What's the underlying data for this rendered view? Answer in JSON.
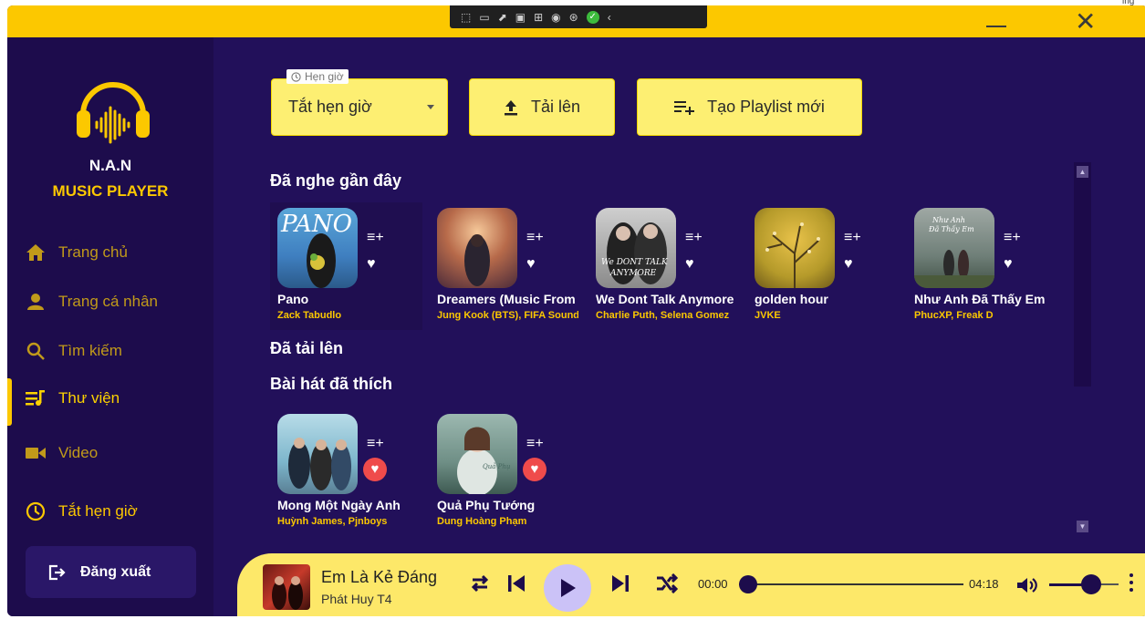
{
  "window": {
    "corner_text": "ing",
    "minimize_label": "—",
    "close_label": "✕"
  },
  "app": {
    "name_line1": "N.A.N",
    "name_line2": "MUSIC PLAYER"
  },
  "sidebar": {
    "items": [
      {
        "label": "Trang chủ",
        "icon": "home-icon"
      },
      {
        "label": "Trang cá nhân",
        "icon": "person-icon"
      },
      {
        "label": "Tìm kiếm",
        "icon": "search-icon"
      },
      {
        "label": "Thư viện",
        "icon": "library-icon",
        "active": true
      },
      {
        "label": "Video",
        "icon": "video-icon"
      }
    ],
    "timer_label": "Tắt hẹn giờ",
    "logout_label": "Đăng xuất"
  },
  "toolbar": {
    "timer_float_label": "Hẹn giờ",
    "timer_value": "Tắt hẹn giờ",
    "upload_label": "Tải lên",
    "new_playlist_label": "Tạo Playlist mới"
  },
  "sections": {
    "recent_title": "Đã nghe gần đây",
    "uploaded_title": "Đã tải lên",
    "liked_title": "Bài hát đã thích"
  },
  "recent": [
    {
      "title": "Pano",
      "artist": "Zack Tabudlo"
    },
    {
      "title": "Dreamers (Music From",
      "artist": "Jung Kook (BTS), FIFA Sound"
    },
    {
      "title": "We Dont Talk Anymore",
      "artist": "Charlie Puth, Selena Gomez"
    },
    {
      "title": "golden hour",
      "artist": "JVKE"
    },
    {
      "title": "Như Anh Đã Thấy Em",
      "artist": "PhucXP, Freak D"
    }
  ],
  "liked": [
    {
      "title": "Mong Một Ngày Anh",
      "artist": "Huỳnh James, Pjnboys"
    },
    {
      "title": "Quả Phụ Tướng",
      "artist": "Dung Hoàng Phạm"
    }
  ],
  "player": {
    "title": "Em Là Kẻ Đáng",
    "artist": "Phát Huy T4",
    "time_current": "00:00",
    "time_total": "04:18",
    "progress": 0,
    "volume": 0.6
  },
  "colors": {
    "accent": "#fcc800",
    "background": "#22105a",
    "sidebar": "#1d0c4c",
    "button": "#fdef72",
    "liked": "#ef4b4b"
  }
}
